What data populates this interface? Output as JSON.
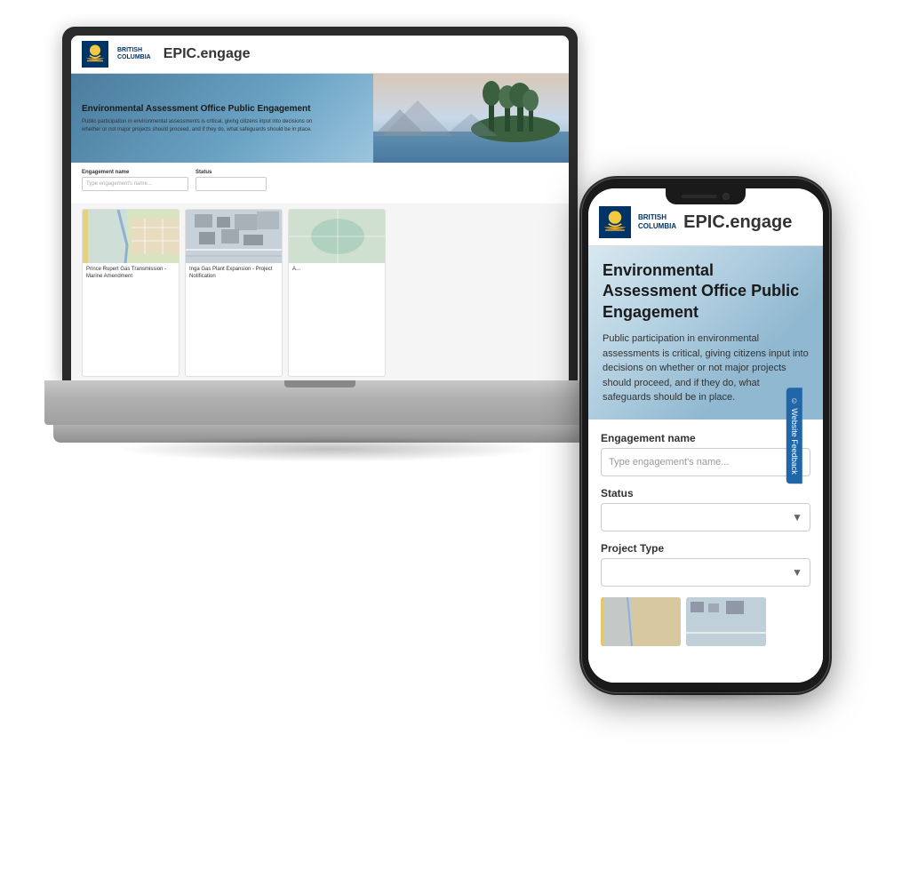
{
  "app": {
    "title": "EPIC.engage",
    "org_name": "British\nColumbia",
    "logo_alt": "BC Government Logo"
  },
  "hero": {
    "heading": "Environmental Assessment Office Public Engagement",
    "description": "Public participation in environmental assessments is critical, giving citizens input into decisions on whether or not major projects should proceed, and if they do, what safeguards should be in place."
  },
  "search": {
    "engagement_label": "Engagement name",
    "engagement_placeholder": "Type engagement's name...",
    "status_label": "Status",
    "project_type_label": "Project Type"
  },
  "cards": [
    {
      "title": "Prince Rupert Gas Transmission - Marine Amendment"
    },
    {
      "title": "Inga Gas Plant Expansion - Project Notification"
    },
    {
      "title": "A..."
    }
  ],
  "feedback": {
    "label": "Website Feedback"
  }
}
